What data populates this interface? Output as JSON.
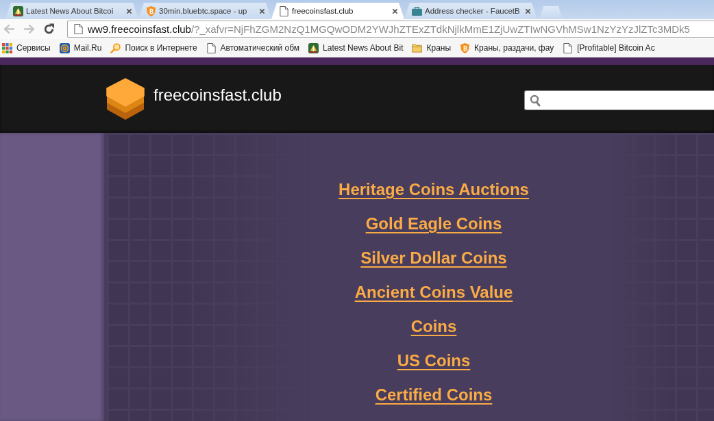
{
  "browser": {
    "tabs": [
      {
        "title": "Latest News About Bitcoi",
        "kind": "news",
        "selected": false
      },
      {
        "title": "30min.bluebtc.space - up",
        "kind": "bitcoin",
        "selected": false
      },
      {
        "title": "freecoinsfast.club",
        "kind": "page",
        "selected": true
      },
      {
        "title": "Address checker - FaucetB",
        "kind": "briefcase",
        "selected": false
      }
    ],
    "nav_buttons": [
      {
        "kind": "back",
        "disabled": true
      },
      {
        "kind": "forward",
        "disabled": true
      },
      {
        "kind": "reload",
        "disabled": false
      }
    ],
    "address_bar": {
      "host": "ww9.freecoinsfast.club",
      "path": "/?_xafvr=NjFhZGM2NzQ1MGQwODM2YWJhZTExZTdkNjlkMmE1ZjUwZTIwNGVhMSw1NzYzYzJlZTc3MDk5"
    },
    "bookmarks": [
      {
        "label": "Сервисы",
        "kind": "apps"
      },
      {
        "label": "Mail.Ru",
        "kind": "mail"
      },
      {
        "label": "Поиск в Интернете",
        "kind": "search"
      },
      {
        "label": "Автоматический обм",
        "kind": "page"
      },
      {
        "label": "Latest News About Bit",
        "kind": "news"
      },
      {
        "label": "Краны",
        "kind": "folder"
      },
      {
        "label": "Краны, раздачи, фау",
        "kind": "bitcoin"
      },
      {
        "label": "[Profitable] Bitcoin Ac",
        "kind": "page"
      }
    ]
  },
  "site": {
    "title": "freecoinsfast.club",
    "links": [
      "Heritage Coins Auctions",
      "Gold Eagle Coins",
      "Silver Dollar Coins",
      "Ancient Coins Value",
      "Coins",
      "US Coins",
      "Certified Coins"
    ]
  }
}
